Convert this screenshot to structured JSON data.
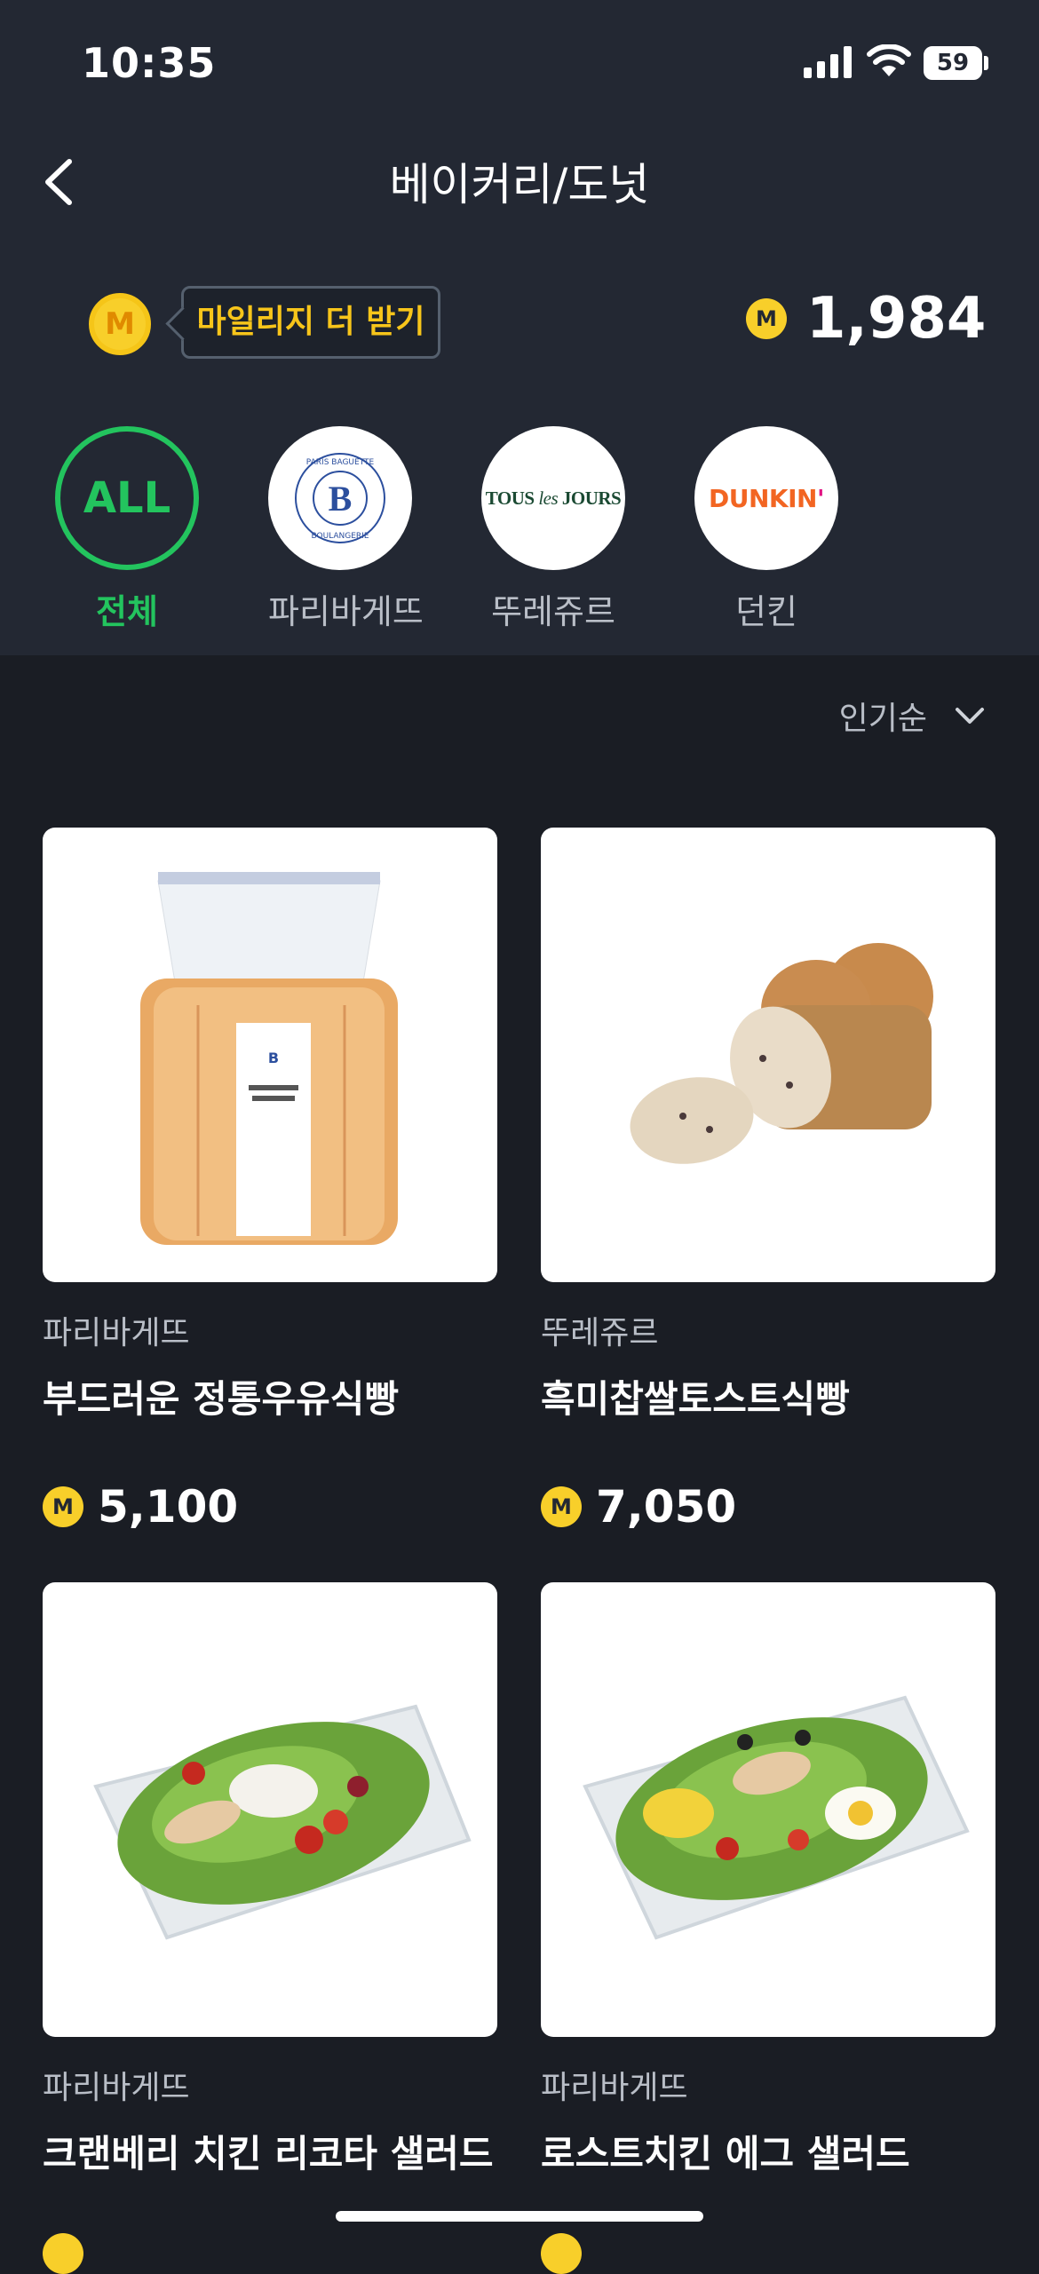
{
  "status_bar": {
    "time": "10:35",
    "battery": "59"
  },
  "header": {
    "title": "베이커리/도넛"
  },
  "mileage": {
    "coin_symbol": "M",
    "earn_more_label": "마일리지 더 받기",
    "points": "1,984"
  },
  "brands": [
    {
      "label": "전체",
      "logo_text": "ALL",
      "active": true
    },
    {
      "label": "파리바게뜨",
      "logo_text": "PARIS BAGUETTE BOULANGERIE"
    },
    {
      "label": "뚜레쥬르",
      "logo_text": "TOUS les JOURS"
    },
    {
      "label": "던킨",
      "logo_text": "DUNKIN'"
    }
  ],
  "sort": {
    "label": "인기순"
  },
  "products": [
    {
      "brand": "파리바게뜨",
      "name": "부드러운 정통우유식빵",
      "price": "5,100"
    },
    {
      "brand": "뚜레쥬르",
      "name": "흑미찹쌀토스트식빵",
      "price": "7,050"
    },
    {
      "brand": "파리바게뜨",
      "name": "크랜베리 치킨 리코타 샐러드",
      "price": ""
    },
    {
      "brand": "파리바게뜨",
      "name": "로스트치킨 에그 샐러드",
      "price": ""
    }
  ],
  "colors": {
    "accent_green": "#23c45e",
    "coin_yellow": "#f8cf2a",
    "header_bg": "#232833",
    "body_bg": "#1a1d24"
  }
}
